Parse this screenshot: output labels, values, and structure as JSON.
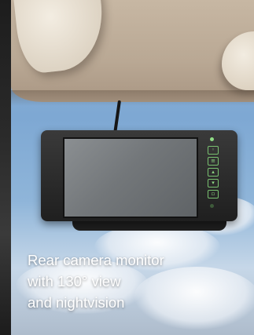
{
  "caption": {
    "line1": "Rear camera monitor",
    "line2": "with 130° view",
    "line3": "and nightvision"
  },
  "monitor": {
    "button_icons": [
      "power-icon",
      "menu-icon",
      "up-icon",
      "down-icon",
      "source-icon"
    ]
  },
  "colors": {
    "sky": "#7ea8d3",
    "headliner": "#b9a894",
    "monitor_body": "#1f1f1f",
    "button_glow": "#8fdc85",
    "caption_text": "#ffffff"
  }
}
